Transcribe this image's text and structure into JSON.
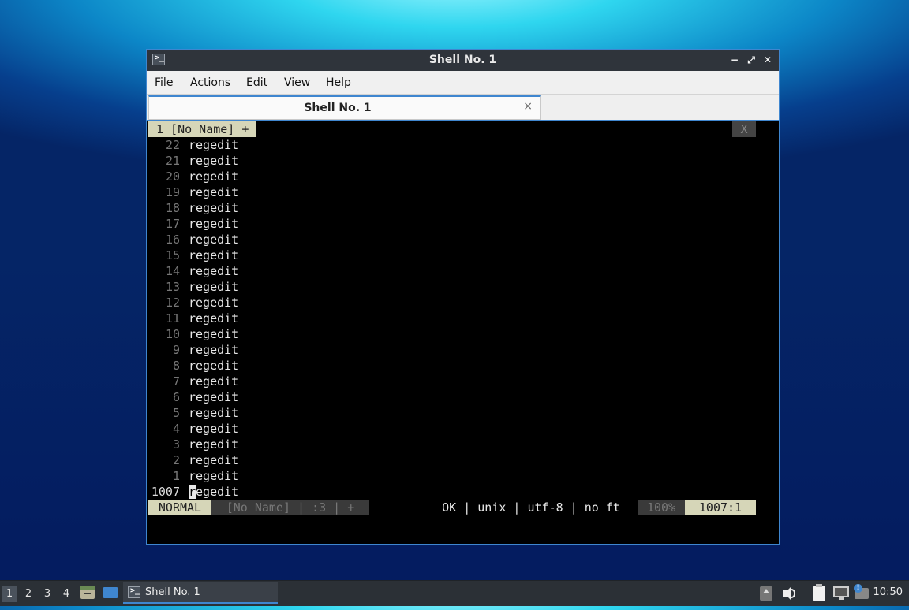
{
  "window": {
    "title": "Shell No. 1",
    "controls": {
      "minimize": "−",
      "maximize": "⤢",
      "close": "✕"
    }
  },
  "menubar": {
    "items": [
      "File",
      "Actions",
      "Edit",
      "View",
      "Help"
    ]
  },
  "tabs": [
    {
      "label": "Shell No. 1",
      "close": "×"
    }
  ],
  "terminal": {
    "bufferline": {
      "label": "1 [No Name] +",
      "close": "X"
    },
    "lines": [
      {
        "num": "22",
        "text": "regedit"
      },
      {
        "num": "21",
        "text": "regedit"
      },
      {
        "num": "20",
        "text": "regedit"
      },
      {
        "num": "19",
        "text": "regedit"
      },
      {
        "num": "18",
        "text": "regedit"
      },
      {
        "num": "17",
        "text": "regedit"
      },
      {
        "num": "16",
        "text": "regedit"
      },
      {
        "num": "15",
        "text": "regedit"
      },
      {
        "num": "14",
        "text": "regedit"
      },
      {
        "num": "13",
        "text": "regedit"
      },
      {
        "num": "12",
        "text": "regedit"
      },
      {
        "num": "11",
        "text": "regedit"
      },
      {
        "num": "10",
        "text": "regedit"
      },
      {
        "num": "9",
        "text": "regedit"
      },
      {
        "num": "8",
        "text": "regedit"
      },
      {
        "num": "7",
        "text": "regedit"
      },
      {
        "num": "6",
        "text": "regedit"
      },
      {
        "num": "5",
        "text": "regedit"
      },
      {
        "num": "4",
        "text": "regedit"
      },
      {
        "num": "3",
        "text": "regedit"
      },
      {
        "num": "2",
        "text": "regedit"
      },
      {
        "num": "1",
        "text": "regedit"
      }
    ],
    "current_line": {
      "num": "1007",
      "cursor_char": "r",
      "rest": "egedit"
    },
    "statusline": {
      "mode": "NORMAL",
      "file": "[No Name] | :3 | +",
      "info": "OK | unix | utf-8 | no ft",
      "percent": "100%",
      "position": "1007:1"
    }
  },
  "taskbar": {
    "workspaces": [
      "1",
      "2",
      "3",
      "4"
    ],
    "active_workspace": "1",
    "task_label": "Shell No. 1",
    "clock": "10:50",
    "icons": [
      "file-manager-icon",
      "desktop-icon",
      "terminal-icon",
      "tray-up-icon",
      "volume-icon",
      "clipboard-icon",
      "network-icon",
      "notification-icon"
    ]
  },
  "colors": {
    "accent": "#3f86cf",
    "status_mode_bg": "#d6d6b8",
    "terminal_bg": "#000000"
  }
}
